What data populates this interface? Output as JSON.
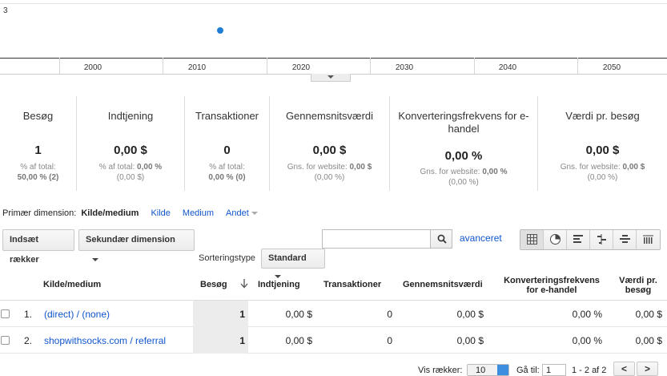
{
  "chart": {
    "y_max_label": "3",
    "x_labels": [
      "2000",
      "2010",
      "2020",
      "2030",
      "2040",
      "2050"
    ]
  },
  "scorecards": [
    {
      "title": "Besøg",
      "value": "1",
      "sub_label": "% af total:",
      "sub_value": "50,00 % (2)"
    },
    {
      "title": "Indtjening",
      "value": "0,00 $",
      "sub_label": "% af total:",
      "sub_bold": "0,00 %",
      "sub_value": "(0,00 $)"
    },
    {
      "title": "Transaktioner",
      "value": "0",
      "sub_label": "% af total:",
      "sub_value": "0,00 % (0)"
    },
    {
      "title": "Gennemsnitsværdi",
      "value": "0,00 $",
      "sub_label": "Gns. for website:",
      "sub_bold": "0,00 $",
      "sub_value": "(0,00 %)"
    },
    {
      "title": "Konverteringsfrekvens for e-handel",
      "value": "0,00 %",
      "sub_label": "Gns. for website:",
      "sub_bold": "0,00 %",
      "sub_value": "(0,00 %)"
    },
    {
      "title": "Værdi pr. besøg",
      "value": "0,00 $",
      "sub_label": "Gns. for website:",
      "sub_bold": "0,00 $",
      "sub_value": "(0,00 %)"
    }
  ],
  "dimensions": {
    "label": "Primær dimension:",
    "active": "Kilde/medium",
    "links": [
      "Kilde",
      "Medium",
      "Andet"
    ]
  },
  "toolbar": {
    "insert_rows": "Indsæt rækker",
    "secondary_dimension": "Sekundær dimension",
    "search_placeholder": "",
    "advanced": "avanceret",
    "sort_label": "Sorteringstype",
    "sort_value": "Standard"
  },
  "table": {
    "headers": {
      "source": "Kilde/medium",
      "visits": "Besøg",
      "revenue": "Indtjening",
      "transactions": "Transaktioner",
      "avg_value": "Gennemsnitsværdi",
      "conversion_l1": "Konverteringsfrekvens",
      "conversion_l2": "for e-handel",
      "per_visit_l1": "Værdi pr.",
      "per_visit_l2": "besøg"
    },
    "rows": [
      {
        "index": "1.",
        "source": "(direct) / (none)",
        "visits": "1",
        "revenue": "0,00 $",
        "transactions": "0",
        "avg_value": "0,00 $",
        "conversion": "0,00 %",
        "per_visit": "0,00 $"
      },
      {
        "index": "2.",
        "source": "shopwithsocks.com / referral",
        "visits": "1",
        "revenue": "0,00 $",
        "transactions": "0",
        "avg_value": "0,00 $",
        "conversion": "0,00 %",
        "per_visit": "0,00 $"
      }
    ]
  },
  "pagination": {
    "show_rows_label": "Vis rækker:",
    "show_rows_value": "10",
    "goto_label": "Gå til:",
    "goto_value": "1",
    "range": "1 - 2 af 2",
    "prev": "<",
    "next": ">"
  },
  "colors": {
    "link": "#1155cc",
    "chart_dot": "#1f7ed4"
  }
}
